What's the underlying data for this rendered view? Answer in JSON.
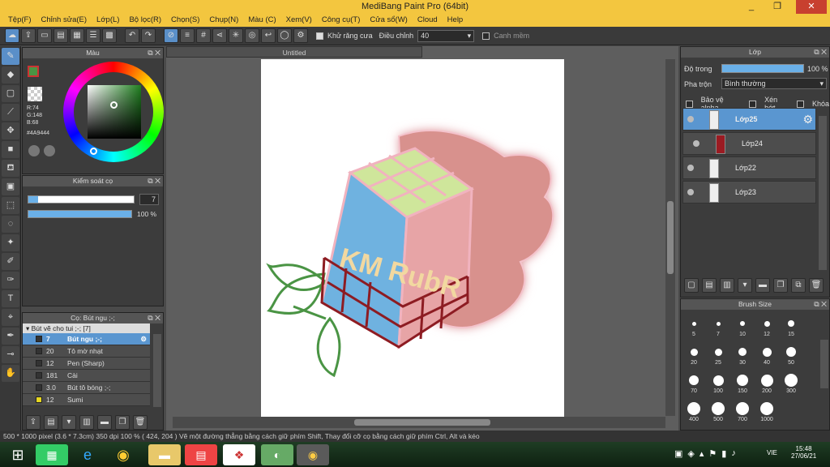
{
  "app": {
    "title": "MediBang Paint Pro (64bit)",
    "min": "_",
    "max": "❐",
    "close": "✕"
  },
  "menu": [
    "Tệp(F)",
    "Chỉnh sửa(E)",
    "Lớp(L)",
    "Bộ lọc(R)",
    "Chọn(S)",
    "Chụp(N)",
    "Màu (C)",
    "Xem(V)",
    "Công cụ(T)",
    "Cửa sổ(W)",
    "Cloud",
    "Help"
  ],
  "toolbar": {
    "antialias_label": "Khử răng cưa",
    "adjust_label": "Điều chỉnh",
    "adjust_value": "40",
    "snap_label": "Canh mềm"
  },
  "color_panel": {
    "title": "Màu",
    "r": "R:74",
    "g": "G:148",
    "b": "B:68",
    "hex": "#4A9444",
    "fg_color": "#4a9444",
    "bg_color": "#5a8fc8"
  },
  "brush_control": {
    "title": "Kiểm soát cọ",
    "size_value": "7",
    "opacity_value": "100 %",
    "size_fraction": 0.09,
    "opacity_fraction": 1.0
  },
  "brush_list": {
    "title": "Cọ: Bút ngu ;-;",
    "group": "Bút vẽ cho tui ;-; [7]",
    "items": [
      {
        "size": "7",
        "name": "Bút ngu ;-;",
        "color": "#333"
      },
      {
        "size": "20",
        "name": "Tô mờ nhạt",
        "color": "#333"
      },
      {
        "size": "12",
        "name": "Pen (Sharp)",
        "color": "#333"
      },
      {
        "size": "181",
        "name": "Cài",
        "color": "#333"
      },
      {
        "size": "3.0",
        "name": "Bút tô bóng ;-;",
        "color": "#333"
      },
      {
        "size": "12",
        "name": "Sumi",
        "color": "#e8d820"
      }
    ]
  },
  "document": {
    "tab": "Untitled"
  },
  "layer_panel": {
    "title": "Lớp",
    "opacity_label": "Độ trong",
    "opacity_value": "100 %",
    "blend_label": "Pha trộn",
    "blend_value": "Bình thường",
    "protect_alpha": "Bảo vệ alpha",
    "clip": "Xén bớt",
    "lock": "Khóa",
    "layers": [
      {
        "name": "Lớp25"
      },
      {
        "name": "Lớp24"
      },
      {
        "name": "Lớp22"
      },
      {
        "name": "Lớp23"
      }
    ]
  },
  "brush_size_panel": {
    "title": "Brush Size",
    "sizes": [
      "5",
      "7",
      "10",
      "12",
      "15",
      "20",
      "25",
      "30",
      "40",
      "50",
      "70",
      "100",
      "150",
      "200",
      "300",
      "400",
      "500",
      "700",
      "1000"
    ]
  },
  "status": {
    "dims": "500 * 1000 pixel",
    "cm": "(3.6 * 7.3cm)",
    "dpi": "350 dpi",
    "zoom": "100 %",
    "coords": "( 424, 204 )",
    "hint": "Vẽ một đường thẳng bằng cách giữ phím Shift, Thay đổi cỡ cọ bằng cách giữ phím Ctrl, Alt và kéo"
  },
  "taskbar": {
    "lang": "VIE",
    "time": "15:48",
    "date": "27/06/21"
  },
  "artwork": {
    "text": "KM RubR"
  }
}
